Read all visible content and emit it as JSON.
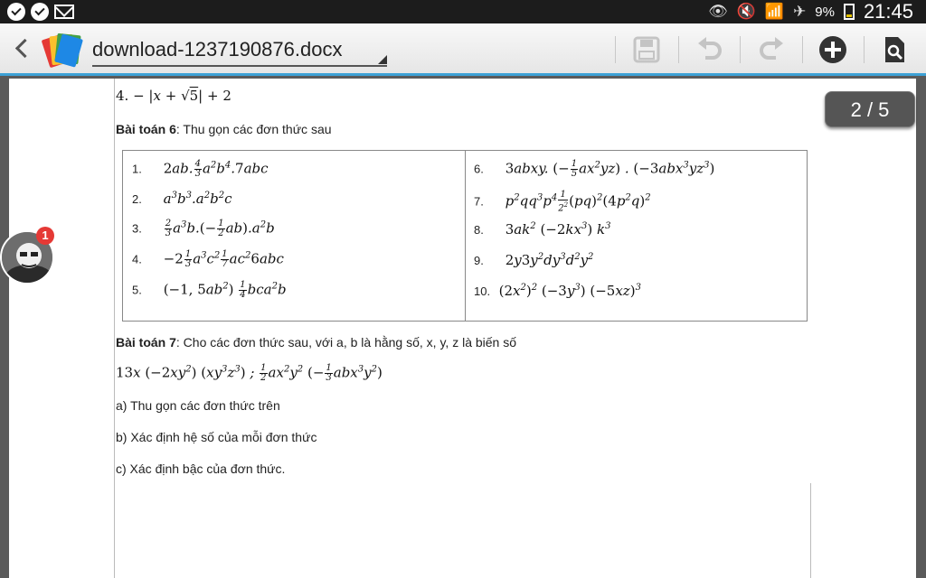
{
  "status_bar": {
    "battery_percent": "9%",
    "time": "21:45"
  },
  "app_bar": {
    "file_name": "download-1237190876.docx"
  },
  "page_indicator": "2 / 5",
  "chathead": {
    "badge_count": "1"
  },
  "document": {
    "line_top": "4. −|x + √5| + 2",
    "problem6": {
      "heading": "Bài toán 6",
      "text": ": Thu gọn các đơn thức sau"
    },
    "table_left": [
      {
        "num": "1.",
        "expr": "2ab.(4/3)a²b⁴.7abc"
      },
      {
        "num": "2.",
        "expr": "a³b³.a²b²c"
      },
      {
        "num": "3.",
        "expr": "(2/3)a³b.(−(1/2)ab).a²b"
      },
      {
        "num": "4.",
        "expr": "−2(1/3)a³c²(1/7)ac²6abc"
      },
      {
        "num": "5.",
        "expr": "(−1,5ab²)(1/4)bca²b"
      }
    ],
    "table_right": [
      {
        "num": "6.",
        "expr": "3abxy.(−(1/5)ax²yz).(−3abx³yz³)"
      },
      {
        "num": "7.",
        "expr": "p²qq³p⁴(1/2²)(pq)²(4p²q)²"
      },
      {
        "num": "8.",
        "expr": "3ak²(−2kx³)k³"
      },
      {
        "num": "9.",
        "expr": "2y3y²dy³d²y²"
      },
      {
        "num": "10.",
        "expr": "(2x²)²(−3y³)(−5xz)³"
      }
    ],
    "problem7": {
      "heading": "Bài toán 7",
      "text": ": Cho các đơn thức sau, với a, b là hằng số, x, y, z là biến số",
      "expression": "13x(−2xy²)(xy³z³) ; (1/2)ax²y²(−(1/3)abx³y²)",
      "part_a": "a) Thu gọn các đơn thức trên",
      "part_b": "b) Xác định hệ số của mỗi đơn thức",
      "part_c": "c) Xác định bậc của đơn thức."
    }
  }
}
